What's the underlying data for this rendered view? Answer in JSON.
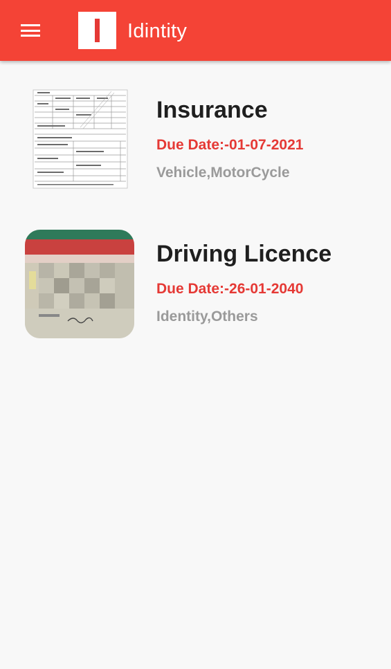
{
  "app_bar": {
    "title": "Idintity",
    "color": "#f44336",
    "menu_icon": "hamburger-menu-icon",
    "logo_letter": "I"
  },
  "documents": [
    {
      "title": "Insurance",
      "due_date": "Due Date:-01-07-2021",
      "tags": "Vehicle,MotorCycle",
      "thumbnail": "insurance-document-thumbnail"
    },
    {
      "title": "Driving Licence",
      "due_date": "Due Date:-26-01-2040",
      "tags": "Identity,Others",
      "thumbnail": "driving-licence-thumbnail"
    }
  ],
  "colors": {
    "due_date": "#e53935",
    "tags": "#9a9a9a",
    "background": "#f8f8f8"
  }
}
